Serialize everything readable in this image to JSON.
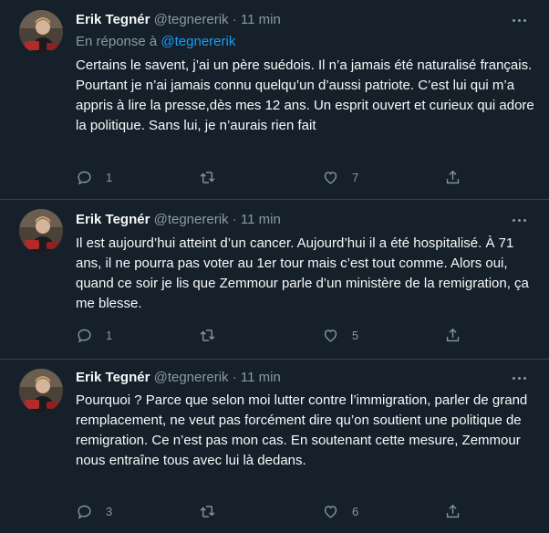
{
  "reply_prefix": "En réponse à",
  "reply_handle": "@tegnererik",
  "tweets": [
    {
      "author_name": "Erik Tegnér",
      "author_handle": "@tegnererik",
      "separator": "·",
      "time": "11 min",
      "text": "Certains le savent, j’ai un père suédois. Il n’a jamais été naturalisé français. Pourtant je n’ai jamais connu quelqu’un d’aussi patriote. C’est lui qui m’a appris à lire la presse,dès mes 12 ans. Un esprit ouvert et curieux qui adore la politique. Sans lui, je n’aurais rien fait",
      "replies": "1",
      "retweets": "",
      "likes": "7"
    },
    {
      "author_name": "Erik Tegnér",
      "author_handle": "@tegnererik",
      "separator": "·",
      "time": "11 min",
      "text": "Il est aujourd’hui atteint d’un cancer. Aujourd’hui il a été hospitalisé. À 71 ans, il ne pourra pas voter au 1er tour mais c’est tout comme. Alors oui, quand ce soir je lis que Zemmour parle d’un ministère de la remigration, ça me blesse.",
      "replies": "1",
      "retweets": "",
      "likes": "5"
    },
    {
      "author_name": "Erik Tegnér",
      "author_handle": "@tegnererik",
      "separator": "·",
      "time": "11 min",
      "text": "Pourquoi ? Parce que selon moi lutter contre l’immigration, parler de grand remplacement, ne veut pas forcément dire qu’on soutient une politique de remigration. Ce n’est pas mon cas. En soutenant cette mesure, Zemmour nous entraîne tous avec lui là dedans.",
      "replies": "3",
      "retweets": "",
      "likes": "6"
    }
  ],
  "icons": {
    "reply": "reply-icon",
    "retweet": "retweet-icon",
    "like": "heart-icon",
    "share": "share-icon",
    "more": "more-icon"
  },
  "colors": {
    "background": "#15202b",
    "text": "#f7f9f9",
    "secondary": "#8b98a5",
    "accent": "#1d9bf0",
    "divider": "#38444d"
  }
}
